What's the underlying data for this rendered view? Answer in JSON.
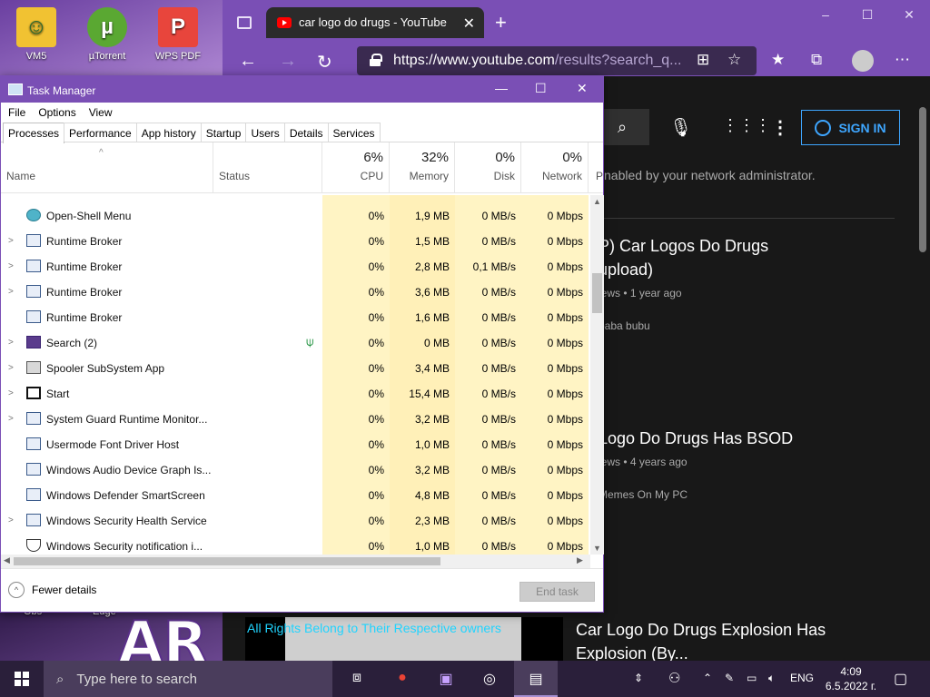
{
  "desktop": {
    "icons": [
      {
        "label": "VM5",
        "icon": "vm-icon"
      },
      {
        "label": "µTorrent",
        "icon": "utorrent-icon"
      },
      {
        "label": "WPS PDF",
        "icon": "wps-pdf-icon"
      }
    ],
    "bottom_labels": [
      "Obs",
      "Edge"
    ],
    "wallpaper_text": "AR"
  },
  "browser": {
    "tab_title": "car logo do drugs - YouTube",
    "url_main": "https://www.youtube.com",
    "url_rest": "/results?search_q...",
    "window_controls": [
      "–",
      "☐",
      "✕"
    ]
  },
  "youtube": {
    "signin_label": "SIGN IN",
    "notice": "nabled by your network administrator.",
    "videos": [
      {
        "title": "P) Car Logos Do Drugs upload)",
        "title_line1": "P) Car Logos Do Drugs",
        "title_line2": "upload)",
        "meta": "iews • 1 year ago",
        "channel": "baba bubu"
      },
      {
        "title": "Logo Do Drugs Has BSOD",
        "title_line1": "Logo Do Drugs Has BSOD",
        "title_line2": "",
        "meta": "iews • 4 years ago",
        "channel": "Memes On My PC"
      },
      {
        "title": "Car Logo Do Drugs Explosion Has Explosion (By...",
        "title_line1": "Car Logo Do Drugs Explosion Has",
        "title_line2": "Explosion (By...",
        "meta": "",
        "channel": ""
      }
    ],
    "thumbnail_text": "All Rights Belong to Their Respective owners"
  },
  "task_manager": {
    "title": "Task Manager",
    "menu": [
      "File",
      "Options",
      "View"
    ],
    "tabs": [
      "Processes",
      "Performance",
      "App history",
      "Startup",
      "Users",
      "Details",
      "Services"
    ],
    "active_tab": "Processes",
    "columns": {
      "name": "Name",
      "status": "Status",
      "cpu": {
        "pct": "6%",
        "label": "CPU"
      },
      "memory": {
        "pct": "32%",
        "label": "Memory"
      },
      "disk": {
        "pct": "0%",
        "label": "Disk"
      },
      "network": {
        "pct": "0%",
        "label": "Network"
      },
      "power_partial": "P"
    },
    "rows": [
      {
        "name": "Open-Shell Menu",
        "expand": false,
        "status_icon": false,
        "cpu": "0%",
        "mem": "1,9 MB",
        "disk": "0 MB/s",
        "net": "0 Mbps",
        "icon": "open-shell-icon"
      },
      {
        "name": "Runtime Broker",
        "expand": true,
        "status_icon": false,
        "cpu": "0%",
        "mem": "1,5 MB",
        "disk": "0 MB/s",
        "net": "0 Mbps",
        "icon": "app-window-icon"
      },
      {
        "name": "Runtime Broker",
        "expand": true,
        "status_icon": false,
        "cpu": "0%",
        "mem": "2,8 MB",
        "disk": "0,1 MB/s",
        "net": "0 Mbps",
        "icon": "app-window-icon"
      },
      {
        "name": "Runtime Broker",
        "expand": true,
        "status_icon": false,
        "cpu": "0%",
        "mem": "3,6 MB",
        "disk": "0 MB/s",
        "net": "0 Mbps",
        "icon": "app-window-icon"
      },
      {
        "name": "Runtime Broker",
        "expand": false,
        "status_icon": false,
        "cpu": "0%",
        "mem": "1,6 MB",
        "disk": "0 MB/s",
        "net": "0 Mbps",
        "icon": "app-window-icon"
      },
      {
        "name": "Search (2)",
        "expand": true,
        "status_icon": true,
        "cpu": "0%",
        "mem": "0 MB",
        "disk": "0 MB/s",
        "net": "0 Mbps",
        "icon": "search-app-icon"
      },
      {
        "name": "Spooler SubSystem App",
        "expand": true,
        "status_icon": false,
        "cpu": "0%",
        "mem": "3,4 MB",
        "disk": "0 MB/s",
        "net": "0 Mbps",
        "icon": "printer-icon"
      },
      {
        "name": "Start",
        "expand": true,
        "status_icon": false,
        "cpu": "0%",
        "mem": "15,4 MB",
        "disk": "0 MB/s",
        "net": "0 Mbps",
        "icon": "start-app-icon"
      },
      {
        "name": "System Guard Runtime Monitor...",
        "expand": true,
        "status_icon": false,
        "cpu": "0%",
        "mem": "3,2 MB",
        "disk": "0 MB/s",
        "net": "0 Mbps",
        "icon": "app-window-icon"
      },
      {
        "name": "Usermode Font Driver Host",
        "expand": false,
        "status_icon": false,
        "cpu": "0%",
        "mem": "1,0 MB",
        "disk": "0 MB/s",
        "net": "0 Mbps",
        "icon": "app-window-icon"
      },
      {
        "name": "Windows Audio Device Graph Is...",
        "expand": false,
        "status_icon": false,
        "cpu": "0%",
        "mem": "3,2 MB",
        "disk": "0 MB/s",
        "net": "0 Mbps",
        "icon": "app-window-icon"
      },
      {
        "name": "Windows Defender SmartScreen",
        "expand": false,
        "status_icon": false,
        "cpu": "0%",
        "mem": "4,8 MB",
        "disk": "0 MB/s",
        "net": "0 Mbps",
        "icon": "app-window-icon"
      },
      {
        "name": "Windows Security Health Service",
        "expand": true,
        "status_icon": false,
        "cpu": "0%",
        "mem": "2,3 MB",
        "disk": "0 MB/s",
        "net": "0 Mbps",
        "icon": "app-window-icon"
      },
      {
        "name": "Windows Security notification i...",
        "expand": false,
        "status_icon": false,
        "cpu": "0%",
        "mem": "1,0 MB",
        "disk": "0 MB/s",
        "net": "0 Mbps",
        "icon": "shield-icon"
      }
    ],
    "footer": {
      "fewer_details": "Fewer details",
      "end_task": "End task"
    }
  },
  "taskbar": {
    "search_placeholder": "Type here to search",
    "language": "ENG",
    "time": "4:09",
    "date": "6.5.2022 г."
  }
}
